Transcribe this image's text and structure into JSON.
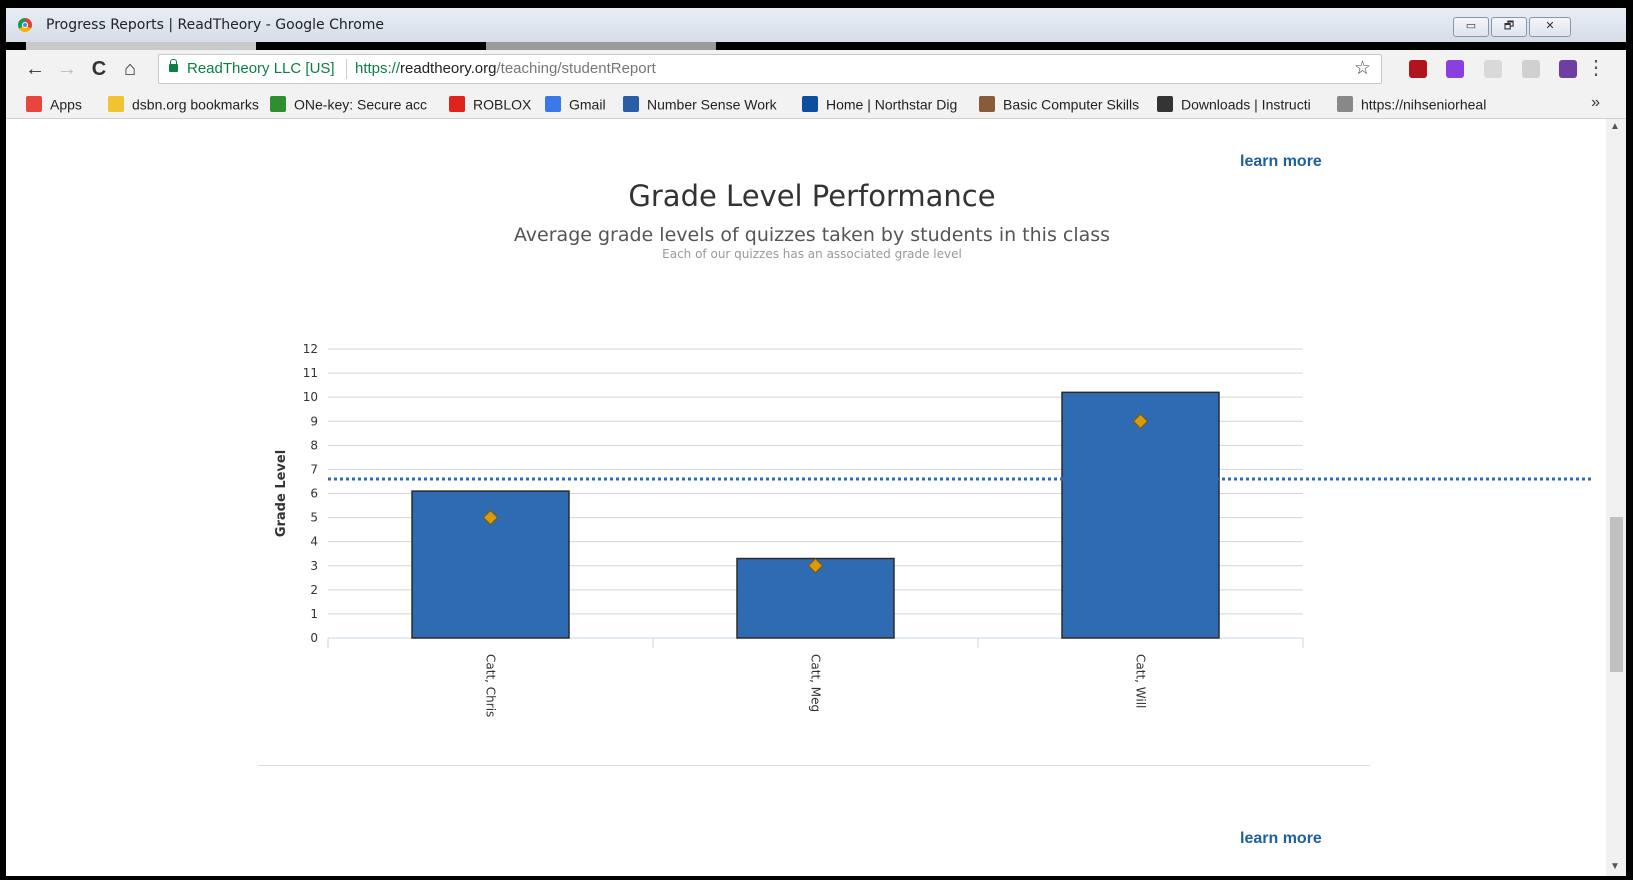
{
  "window": {
    "title": "Progress Reports | ReadTheory - Google Chrome",
    "minimize_label": "▭",
    "restore_label": "🗗",
    "close_label": "✕"
  },
  "toolbar": {
    "back_icon": "←",
    "forward_icon": "→",
    "reload_icon": "C",
    "home_icon": "⌂",
    "org": "ReadTheory LLC [US]",
    "url_scheme": "https://",
    "url_host": "readtheory.org",
    "url_path": "/teaching/studentReport",
    "star_icon": "☆",
    "menu_icon": "⋮"
  },
  "bookmarks": {
    "items": [
      {
        "label": "Apps",
        "icon": "apps-grid-icon",
        "color": "#e8453c"
      },
      {
        "label": "dsbn.org bookmarks",
        "icon": "folder-icon",
        "color": "#f2c230"
      },
      {
        "label": "ONe-key: Secure acc",
        "icon": "onekey-icon",
        "color": "#2f8f2f"
      },
      {
        "label": "ROBLOX",
        "icon": "roblox-icon",
        "color": "#e0231b"
      },
      {
        "label": "Gmail",
        "icon": "gmail-icon",
        "color": "#3b78e7"
      },
      {
        "label": "Number Sense Work",
        "icon": "m-icon",
        "color": "#2a5ca8"
      },
      {
        "label": "Home | Northstar Dig",
        "icon": "n-icon",
        "color": "#0d4ea0"
      },
      {
        "label": "Basic Computer Skills",
        "icon": "globe-icon",
        "color": "#8a5a3a"
      },
      {
        "label": "Downloads | Instructi",
        "icon": "a-icon",
        "color": "#333333"
      },
      {
        "label": "https://nihseniorheal",
        "icon": "page-icon",
        "color": "#888888"
      }
    ],
    "overflow_icon": "»"
  },
  "page": {
    "learn_more_top": "learn more",
    "learn_more_bottom": "learn more",
    "scroll_up_icon": "▲",
    "scroll_down_icon": "▼"
  },
  "chart_data": {
    "type": "bar",
    "title": "Grade Level Performance",
    "subtitle": "Average grade levels of quizzes taken by students in this class",
    "note": "Each of our quizzes has an associated grade level",
    "ylabel": "Grade Level",
    "xlabel": "",
    "ylim": [
      0,
      12
    ],
    "yticks": [
      0,
      1,
      2,
      3,
      4,
      5,
      6,
      7,
      8,
      9,
      10,
      11,
      12
    ],
    "categories": [
      "Catt, Chris",
      "Catt, Meg",
      "Catt, Will"
    ],
    "series": [
      {
        "kind": "bar",
        "values": [
          6.1,
          3.3,
          10.2
        ],
        "color": "#2e6bb2"
      },
      {
        "kind": "marker",
        "values": [
          5,
          3,
          9
        ],
        "color": "#d99a0b"
      }
    ],
    "reference_line": {
      "value": 6.6,
      "color": "#2e6bb2",
      "style": "dotted"
    },
    "grid": true
  }
}
